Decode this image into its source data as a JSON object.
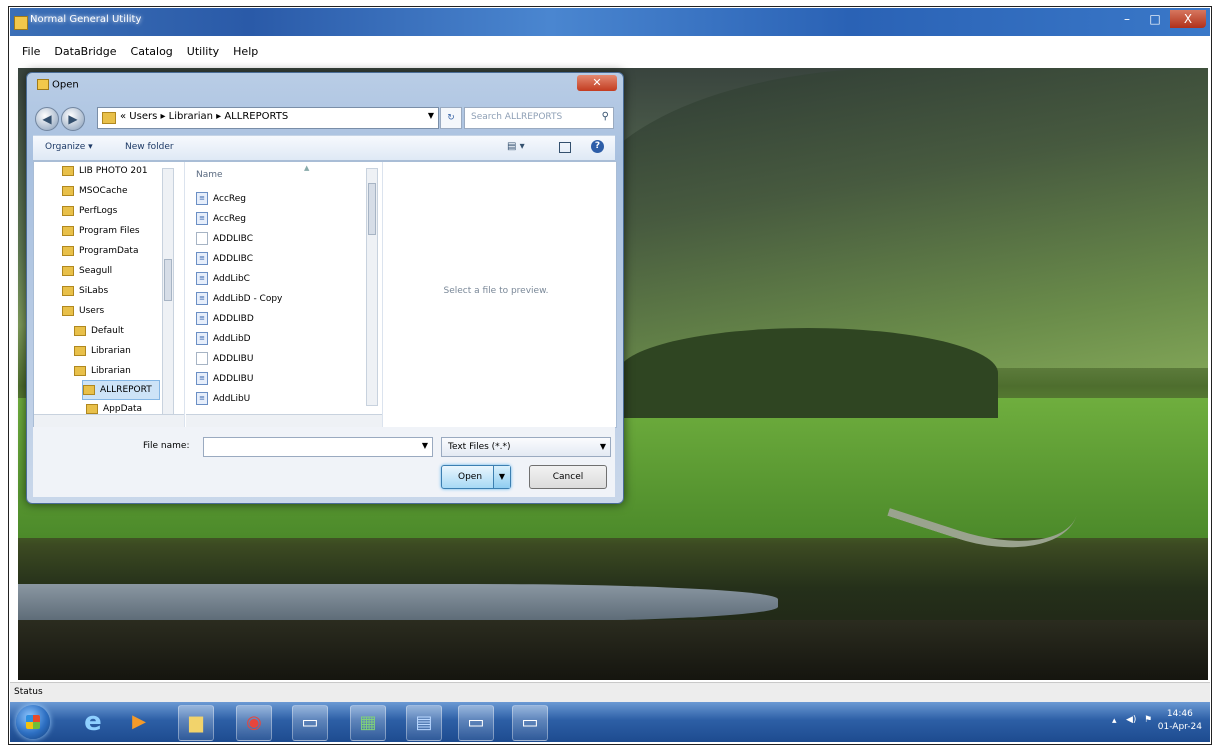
{
  "window": {
    "title": "Normal General Utility",
    "controls": [
      "–",
      "□",
      "X"
    ]
  },
  "menu": [
    "File",
    "DataBridge",
    "Catalog",
    "Utility",
    "Help"
  ],
  "status": "Status",
  "dialog": {
    "title": "Open",
    "breadcrumb": "« Users ▸ Librarian ▸ ALLREPORTS",
    "search_placeholder": "Search ALLREPORTS",
    "organize_label": "Organize ▾",
    "new_folder_label": "New folder",
    "nav_items": [
      {
        "label": "LIB PHOTO 201",
        "indent": 1
      },
      {
        "label": "MSOCache",
        "indent": 1
      },
      {
        "label": "PerfLogs",
        "indent": 1
      },
      {
        "label": "Program Files",
        "indent": 1
      },
      {
        "label": "ProgramData",
        "indent": 1
      },
      {
        "label": "Seagull",
        "indent": 1
      },
      {
        "label": "SiLabs",
        "indent": 1
      },
      {
        "label": "Users",
        "indent": 1
      },
      {
        "label": "Default",
        "indent": 2
      },
      {
        "label": "Librarian",
        "indent": 2
      },
      {
        "label": "Librarian",
        "indent": 2
      },
      {
        "label": "ALLREPORT",
        "indent": 3,
        "selected": true
      },
      {
        "label": "AppData",
        "indent": 3
      }
    ],
    "column_header": "Name",
    "files": [
      {
        "name": "AccReg",
        "type": "doc"
      },
      {
        "name": "AccReg",
        "type": "doc"
      },
      {
        "name": "ADDLIBC",
        "type": "plain"
      },
      {
        "name": "ADDLIBC",
        "type": "doc"
      },
      {
        "name": "AddLibC",
        "type": "doc"
      },
      {
        "name": "AddLibD - Copy",
        "type": "doc"
      },
      {
        "name": "ADDLIBD",
        "type": "doc"
      },
      {
        "name": "AddLibD",
        "type": "doc"
      },
      {
        "name": "ADDLIBU",
        "type": "plain"
      },
      {
        "name": "ADDLIBU",
        "type": "doc"
      },
      {
        "name": "AddLibU",
        "type": "doc"
      }
    ],
    "preview_message": "Select a file to preview.",
    "file_name_label": "File name:",
    "file_name_value": "",
    "filter_value": "Text Files (*.*)",
    "open_label": "Open",
    "cancel_label": "Cancel"
  },
  "taskbar": {
    "clock_time": "14:46",
    "clock_date": "01-Apr-24"
  }
}
